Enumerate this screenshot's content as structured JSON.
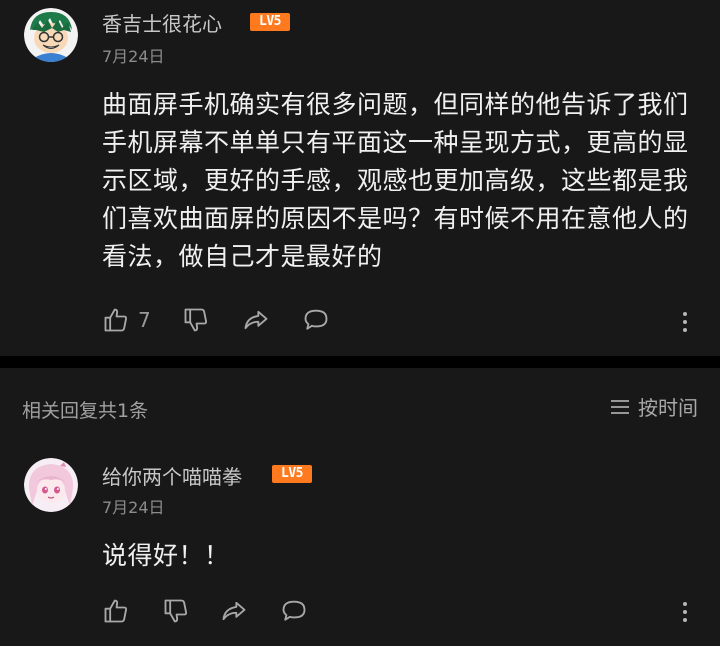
{
  "comment": {
    "username": "香吉士很花心",
    "level": "LV5",
    "date": "7月24日",
    "lines": [
      "曲面屏手机确实有很多问题，但同样的他告诉了我们",
      "手机屏幕不单单只有平面这一种呈现方式，更高的显",
      "示区域，更好的手感，观感也更加高级，这些都是我",
      "们喜欢曲面屏的原因不是吗？有时候不用在意他人的",
      "看法，做自己才是最好的"
    ],
    "like_count": "7",
    "icons": [
      "thumbs-up-icon",
      "thumbs-down-icon",
      "share-icon",
      "reply-bubble-icon",
      "more-vertical-icon"
    ]
  },
  "replies_header": {
    "title": "相关回复共1条",
    "sort_label": "按时间",
    "sort_icon": "list-icon"
  },
  "reply": {
    "username": "给你两个喵喵拳",
    "level": "LV5",
    "date": "7月24日",
    "text": "说得好！！"
  },
  "colors": {
    "background": "#181818",
    "divider": "#000000",
    "level_badge": "#ff7a1f"
  }
}
